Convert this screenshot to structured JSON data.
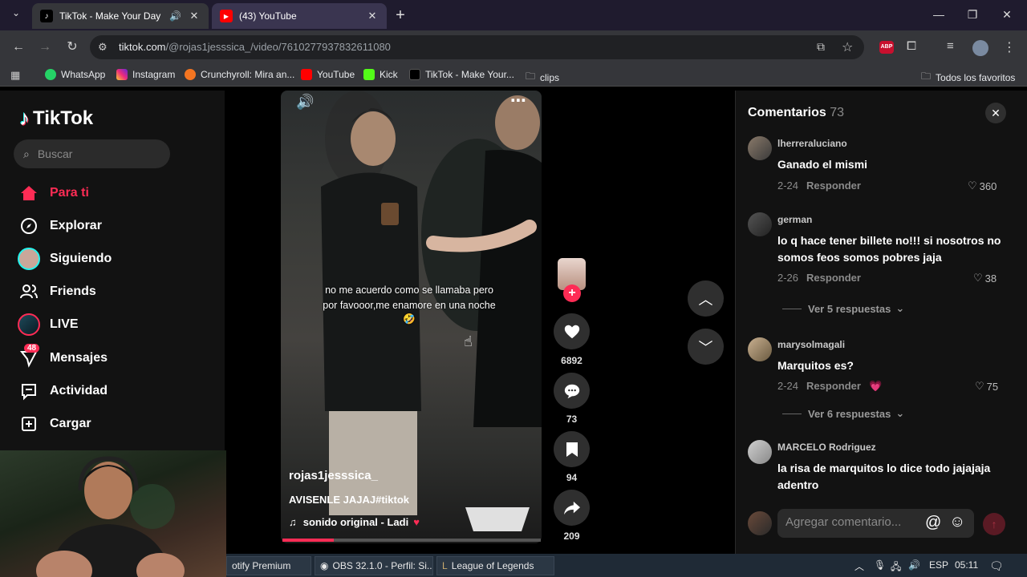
{
  "browser": {
    "tabs": [
      {
        "title": "TikTok - Make Your Day",
        "active": true
      },
      {
        "title": "(43) YouTube",
        "active": false
      }
    ],
    "new_tab_label": "+",
    "url_host": "tiktok.com",
    "url_path": "/@rojas1jesssica_/video/7610277937832611080",
    "bookmarks": [
      "WhatsApp",
      "Instagram",
      "Crunchyroll: Mira an...",
      "YouTube",
      "Kick",
      "TikTok - Make Your...",
      "clips"
    ],
    "all_bookmarks_label": "Todos los favoritos"
  },
  "sidebar": {
    "logo_text": "TikTok",
    "search_placeholder": "Buscar",
    "items": [
      {
        "label": "Para ti",
        "active": true
      },
      {
        "label": "Explorar"
      },
      {
        "label": "Siguiendo"
      },
      {
        "label": "Friends"
      },
      {
        "label": "LIVE"
      },
      {
        "label": "Mensajes",
        "badge": "48"
      },
      {
        "label": "Actividad"
      },
      {
        "label": "Cargar"
      }
    ]
  },
  "video": {
    "caption_line1": "no me acuerdo como se llamaba pero",
    "caption_line2": "por favooor,me enamore en una noche",
    "caption_emoji": "🤣",
    "author": "rojas1jesssica_",
    "description": "AVISENLE JAJAJ#tiktok",
    "sound": "sonido original - Ladi",
    "progress": 0.2
  },
  "actions": {
    "likes": "6892",
    "comments": "73",
    "saves": "94",
    "shares": "209"
  },
  "comments": {
    "title": "Comentarios",
    "count": "73",
    "items": [
      {
        "user": "lherreraluciano",
        "text": "Ganado el mismi",
        "date": "2-24",
        "likes": "360"
      },
      {
        "user": "german",
        "text": "lo q hace tener billete no!!! si nosotros no somos feos somos pobres jaja",
        "date": "2-26",
        "likes": "38",
        "replies": "Ver 5 respuestas"
      },
      {
        "user": "marysolmagali",
        "text": "Marquitos es?",
        "date": "2-24",
        "likes": "75",
        "replies": "Ver 6 respuestas"
      },
      {
        "user": "MARCELO Rodriguez",
        "text": "la risa de marquitos lo dice todo jajajaja adentro"
      }
    ],
    "reply_label": "Responder",
    "input_placeholder": "Agregar comentario..."
  },
  "taskbar": {
    "items": [
      "otify Premium",
      "OBS 32.1.0 - Perfil: Si...",
      "League of Legends"
    ],
    "lang": "ESP",
    "time": "05:11"
  },
  "colors": {
    "accent": "#fe2c55",
    "bg": "#121212"
  }
}
